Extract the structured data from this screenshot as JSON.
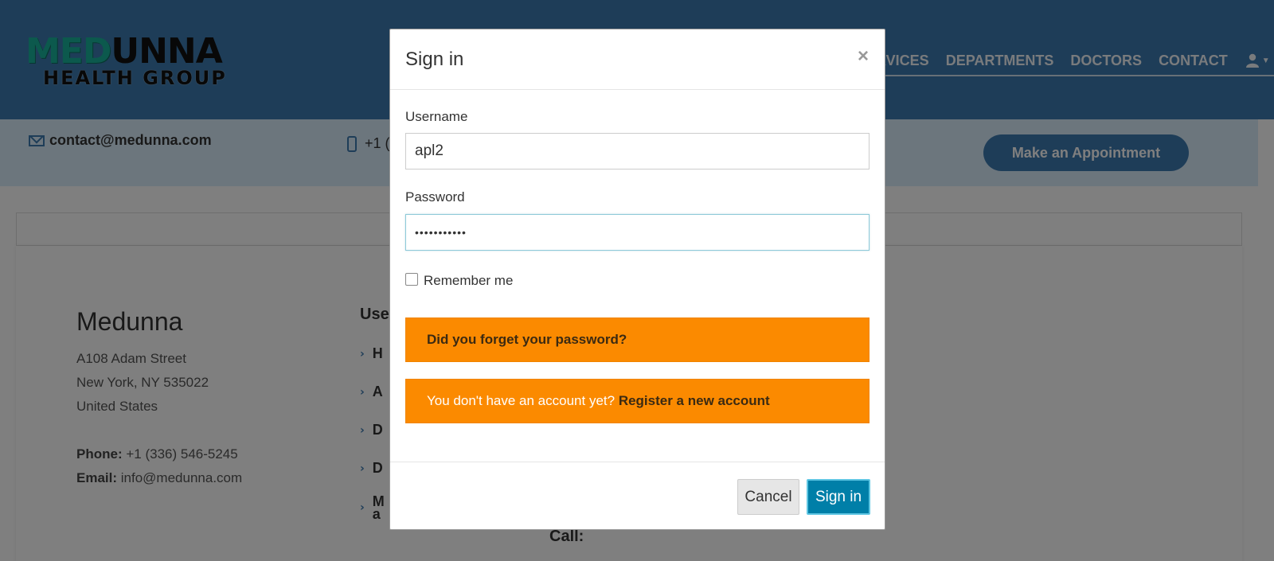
{
  "header": {
    "logo_med": "MED",
    "logo_unna": "UNNA",
    "logo_sub": "HEALTH GROUP",
    "nav": [
      "RVICES",
      "DEPARTMENTS",
      "DOCTORS",
      "CONTACT"
    ],
    "user_icon": "user-icon"
  },
  "infobar": {
    "email": "contact@medunna.com",
    "phone": "+1 (",
    "appointment_button": "Make an Appointment"
  },
  "footer": {
    "brand": "Medunna",
    "address_line1": "A108 Adam Street",
    "address_line2": "New York, NY 535022",
    "address_line3": "United States",
    "phone_label": "Phone:",
    "phone_value": "+1 (336) 546-5245",
    "email_label": "Email:",
    "email_value": "info@medunna.com",
    "links_title": "Use",
    "links": [
      "H",
      "A",
      "D",
      "D",
      "M"
    ],
    "link_last_second_line": "a",
    "call": "Call:"
  },
  "modal": {
    "title": "Sign in",
    "close": "×",
    "username_label": "Username",
    "username_value": "apl2",
    "password_label": "Password",
    "password_value": "•••••••••••",
    "remember_label": "Remember me",
    "forgot_password": "Did you forget your password?",
    "no_account_text": "You don't have an account yet? ",
    "register_link": "Register a new account",
    "cancel_button": "Cancel",
    "signin_button": "Sign in"
  },
  "colors": {
    "header_bg": "#3d7ab0",
    "infobar_bg": "#d8ecfb",
    "alert_orange": "#fb8a00",
    "signin_blue": "#007fa8"
  }
}
